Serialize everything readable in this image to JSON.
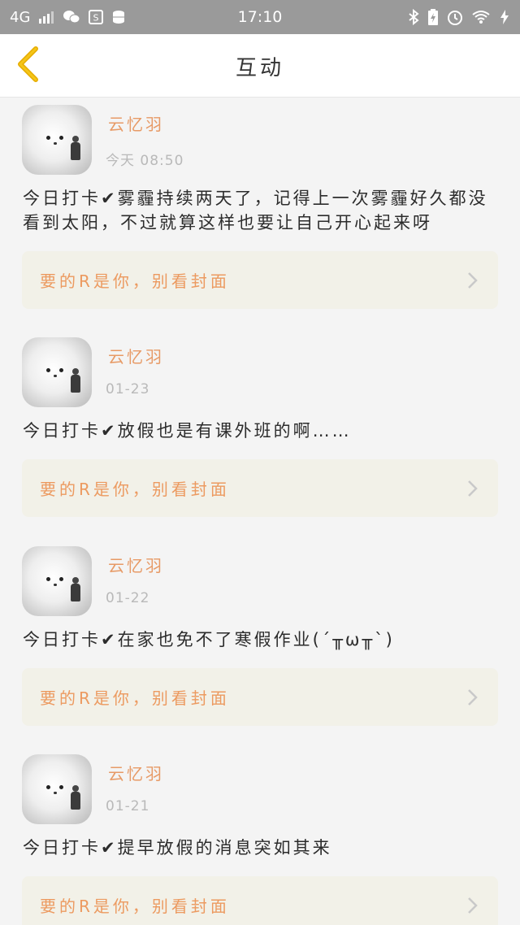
{
  "status_bar": {
    "network": "4G",
    "time": "17:10",
    "icons_left": [
      "signal-icon",
      "wechat-icon",
      "s-badge-icon",
      "storage-icon"
    ],
    "icons_right": [
      "bluetooth-icon",
      "battery-icon",
      "alarm-icon",
      "wifi-icon",
      "charging-icon"
    ]
  },
  "header": {
    "title": "互动",
    "back_icon": "chevron-left-icon",
    "accent_color": "#f0b400"
  },
  "posts": [
    {
      "username": "云忆羽",
      "time": "今天 08:50",
      "content": "今日打卡✔雾霾持续两天了，记得上一次雾霾好久都没看到太阳，不过就算这样也要让自己开心起来呀",
      "link_text": "要的R是你，别看封面"
    },
    {
      "username": "云忆羽",
      "time": "01-23",
      "content": "今日打卡✔放假也是有课外班的啊……",
      "link_text": "要的R是你，别看封面"
    },
    {
      "username": "云忆羽",
      "time": "01-22",
      "content": "今日打卡✔在家也免不了寒假作业(´╥ω╥`)",
      "link_text": "要的R是你，别看封面"
    },
    {
      "username": "云忆羽",
      "time": "01-21",
      "content": "今日打卡✔提早放假的消息突如其来",
      "link_text": "要的R是你，别看封面"
    }
  ],
  "colors": {
    "username": "#e79a66",
    "link_text": "#ec9a60",
    "link_bg": "#f2f1e8",
    "background": "#f4f4f4"
  }
}
